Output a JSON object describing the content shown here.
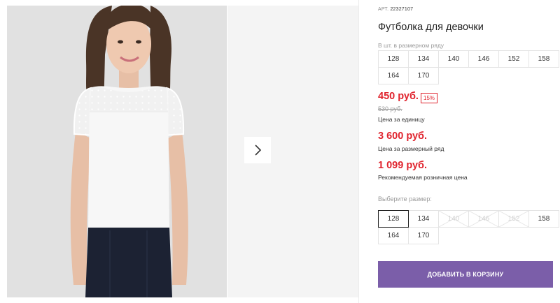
{
  "gallery": {
    "next_icon": "chevron-right-icon"
  },
  "product": {
    "article_label": "АРТ.",
    "article_number": "22327107",
    "title": "Футболка для девочки"
  },
  "size_row": {
    "caption": "В шт. в размерном ряду",
    "sizes": [
      "128",
      "134",
      "140",
      "146",
      "152",
      "158",
      "164",
      "170"
    ]
  },
  "pricing": {
    "unit_price": "450 руб.",
    "discount_badge": "15%",
    "old_price": "530 руб.",
    "unit_note": "Цена за единицу",
    "row_price": "3 600 руб.",
    "row_note": "Цена за размерный ряд",
    "retail_price": "1 099 руб.",
    "retail_note": "Рекомендуемая розничная цена"
  },
  "size_select": {
    "label": "Выберите размер:",
    "selected": "128",
    "disabled": [
      "140",
      "146",
      "152"
    ],
    "sizes": [
      "128",
      "134",
      "140",
      "146",
      "152",
      "158",
      "164",
      "170"
    ]
  },
  "cart": {
    "add_label": "ДОБАВИТЬ В КОРЗИНУ"
  },
  "colors": {
    "accent": "#7b5ea9",
    "price_red": "#e0242e"
  }
}
